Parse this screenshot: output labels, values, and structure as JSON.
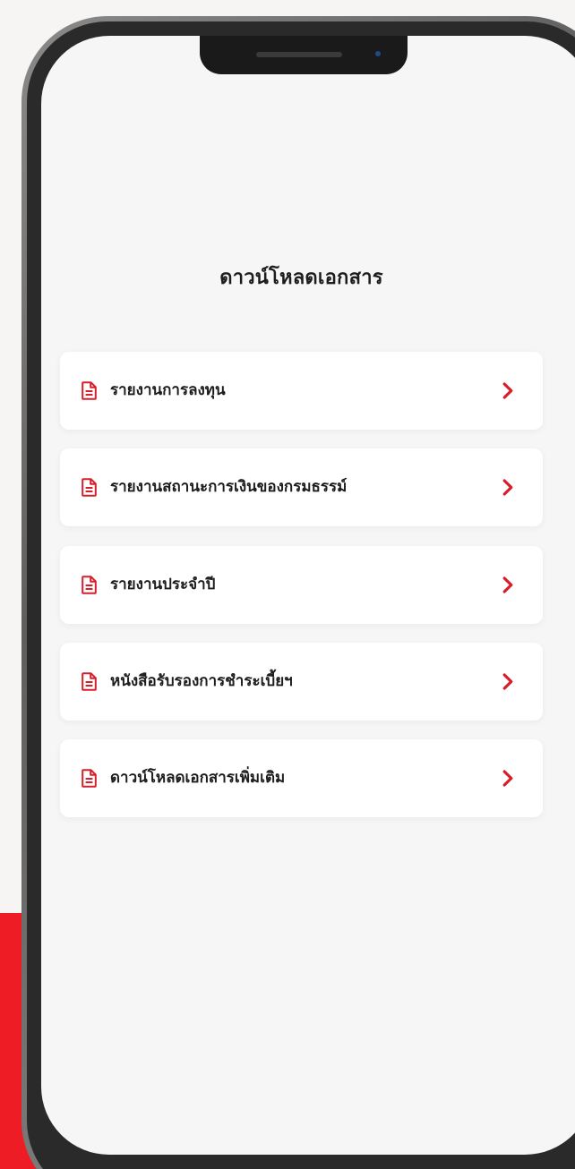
{
  "page": {
    "title": "ดาวน์โหลดเอกสาร"
  },
  "menu": {
    "items": [
      {
        "label": "รายงานการลงทุน",
        "icon": "document-icon"
      },
      {
        "label": "รายงานสถานะการเงินของกรมธรรม์",
        "icon": "document-icon"
      },
      {
        "label": "รายงานประจำปี",
        "icon": "document-icon"
      },
      {
        "label": "หนังสือรับรองการชำระเบี้ยฯ",
        "icon": "document-icon"
      },
      {
        "label": "ดาวน์โหลดเอกสารเพิ่มเติม",
        "icon": "document-icon"
      }
    ]
  },
  "colors": {
    "accent": "#d71f2b",
    "background": "#f6f6f6",
    "card": "#ffffff",
    "text": "#1d1d1d",
    "brand_red": "#ee1c25"
  }
}
